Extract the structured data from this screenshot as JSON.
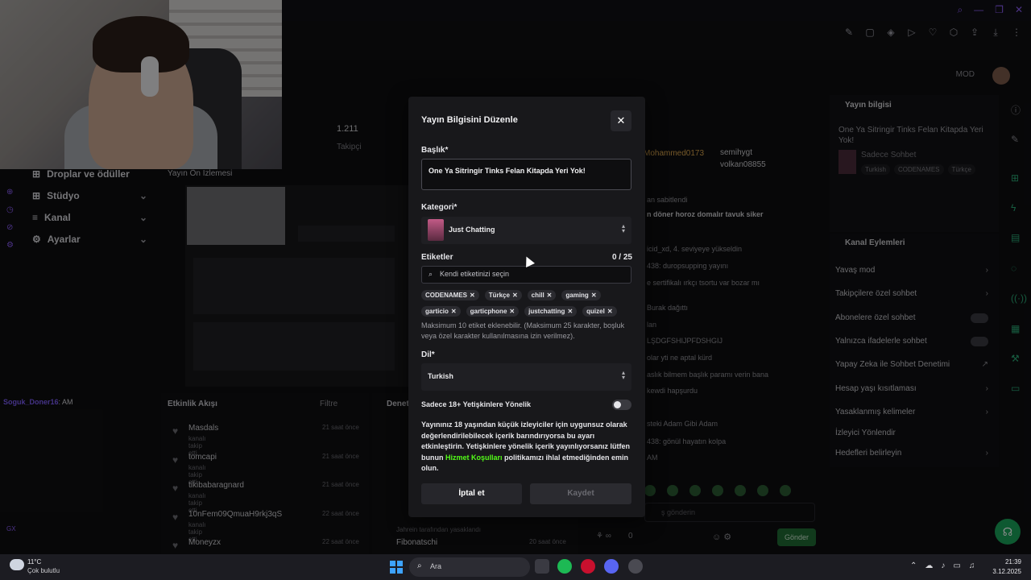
{
  "background": {
    "stats": {
      "followers_value": "1.211",
      "followers_label": "Takipçi"
    },
    "leftnav": {
      "items": [
        "Droplar ve ödüller",
        "Stüdyo",
        "Kanal",
        "Ayarlar"
      ]
    },
    "preview_title": "Yayın Ön İzlemesi",
    "left_chat": {
      "user": "Soguk_Doner16",
      "text": ": AM"
    },
    "feed": {
      "title": "Etkinlik Akışı",
      "filter": "Filtre",
      "items": [
        {
          "user": "Masdals",
          "sub": "kanalı takip etti",
          "time": "21 saat önce"
        },
        {
          "user": "tomcapi",
          "sub": "kanalı takip etti",
          "time": "21 saat önce"
        },
        {
          "user": "tikibabaragnard",
          "sub": "kanalı takip etti",
          "time": "21 saat önce"
        },
        {
          "user": "10nFem09QmuaH9rkj3qS",
          "sub": "kanalı takip etti",
          "time": "22 saat önce"
        },
        {
          "user": "Moneyzx",
          "sub": "kanalı takip etti",
          "time": "22 saat önce"
        }
      ]
    },
    "feed2": {
      "title": "Denet",
      "last_item": "Fibonatschi",
      "last_time": "20 saat önce",
      "banned_text": "Jahrein tarafından yasaklandı"
    },
    "chat": {
      "users": [
        {
          "name": "Mohammed0173",
          "color": "#d4a04a"
        },
        {
          "name": "semihygt",
          "color": "#c9c9cd"
        },
        {
          "name": "volkan08855",
          "color": "#c9c9cd"
        }
      ],
      "pinned_title": "an sabitlendi",
      "pinned_text": "n döner horoz domalır tavuk siker",
      "messages": [
        "icid_xd, 4. seviyeye yükseldin",
        "438: duropsupping yayını",
        "e sertifikalı ırkçı tsortu var bozar mı",
        "Burak dağıttı",
        "lan",
        "LŞDGFSHIJPFDSHGIJ",
        "olar yti ne aptal kürd",
        "aslık bilmem başlık paramı verin bana",
        "kewdi hapşurdu",
        "steki Adam Gibi Adam",
        "438: gönül hayatın kolpa",
        "AM"
      ],
      "input_placeholder": "ş gönderin",
      "send_label": "Gönder",
      "viewer_count": "0"
    },
    "stream_info": {
      "title": "Yayın bilgisi",
      "stream_title": "One Ya Sitringir Tinks Felan Kitapda Yeri Yok!",
      "category": "Sadece Sohbet",
      "tags": [
        "Turkish",
        "CODENAMES",
        "Türkçe"
      ]
    },
    "channel_actions": {
      "title": "Kanal Eylemleri",
      "items": [
        {
          "label": "Yavaş mod",
          "type": "arrow"
        },
        {
          "label": "Takipçilere özel sohbet",
          "type": "arrow"
        },
        {
          "label": "Abonelere özel sohbet",
          "type": "toggle"
        },
        {
          "label": "Yalnızca ifadelerle sohbet",
          "type": "toggle"
        },
        {
          "label": "Yapay Zeka ile Sohbet Denetimi",
          "type": "ext"
        },
        {
          "label": "Hesap yaşı kısıtlaması",
          "type": "arrow"
        },
        {
          "label": "Yasaklanmış kelimeler",
          "type": "arrow"
        },
        {
          "label": "İzleyici Yönlendir",
          "type": "none"
        },
        {
          "label": "Hedefleri belirleyin",
          "type": "arrow"
        }
      ]
    },
    "gx_label": "GX"
  },
  "modal": {
    "title": "Yayın Bilgisini Düzenle",
    "close_icon": "✕",
    "title_label": "Başlık*",
    "title_value": "One Ya Sitringir Tinks Felan Kitapda Yeri Yok!",
    "category_label": "Kategori*",
    "category_value": "Just Chatting",
    "tags_label": "Etiketler",
    "tags_count": "0 / 25",
    "tag_search_placeholder": "Kendi etiketinizi seçin",
    "tags_row1": [
      "CODENAMES",
      "Türkçe",
      "chill",
      "gaming"
    ],
    "tags_row2": [
      "garticio",
      "garticphone",
      "justchatting",
      "quizel"
    ],
    "tags_help": "Maksimum 10 etiket eklenebilir. (Maksimum 25 karakter, boşluk veya özel karakter kullanılmasına izin verilmez).",
    "language_label": "Dil*",
    "language_value": "Turkish",
    "adult_label": "Sadece 18+ Yetişkinlere Yönelik",
    "adult_enabled": false,
    "warning_pre": "Yayınınız 18 yaşından küçük izleyiciler için uygunsuz olarak değerlendirilebilecek içerik barındırıyorsa bu ayarı etkinleştirin. Yetişkinlere yönelik içerik yayınlıyorsanız lütfen bunun ",
    "warning_link": "Hizmet Koşulları",
    "warning_post": " politikamızı ihlal etmediğinden emin olun.",
    "cancel_label": "İptal et",
    "save_label": "Kaydet"
  },
  "taskbar": {
    "temperature": "11°C",
    "condition": "Çok bulutlu",
    "search_label": "Ara",
    "time": "21:39",
    "date": "3.12.2025"
  },
  "colors": {
    "accent_green": "#53fc18",
    "brand_purple": "#8a5cf5"
  }
}
